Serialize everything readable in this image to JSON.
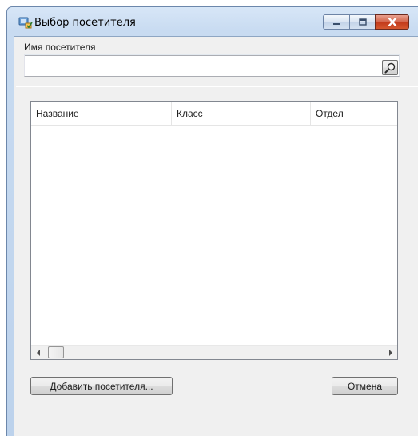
{
  "window": {
    "title": "Выбор посетителя",
    "icon": "visitor-app-icon",
    "controls": [
      "minimize-icon",
      "maximize-icon",
      "close-icon"
    ]
  },
  "search": {
    "label": "Имя посетителя",
    "value": "",
    "placeholder": "",
    "button_icon": "search-icon"
  },
  "table": {
    "columns": [
      "Название",
      "Класс",
      "Отдел"
    ],
    "rows": []
  },
  "buttons": {
    "add": "Добавить посетителя...",
    "cancel": "Отмена"
  },
  "colors": {
    "frame": "#c8dbf1",
    "client": "#f0f0f0",
    "close_button": "#c2391b"
  }
}
